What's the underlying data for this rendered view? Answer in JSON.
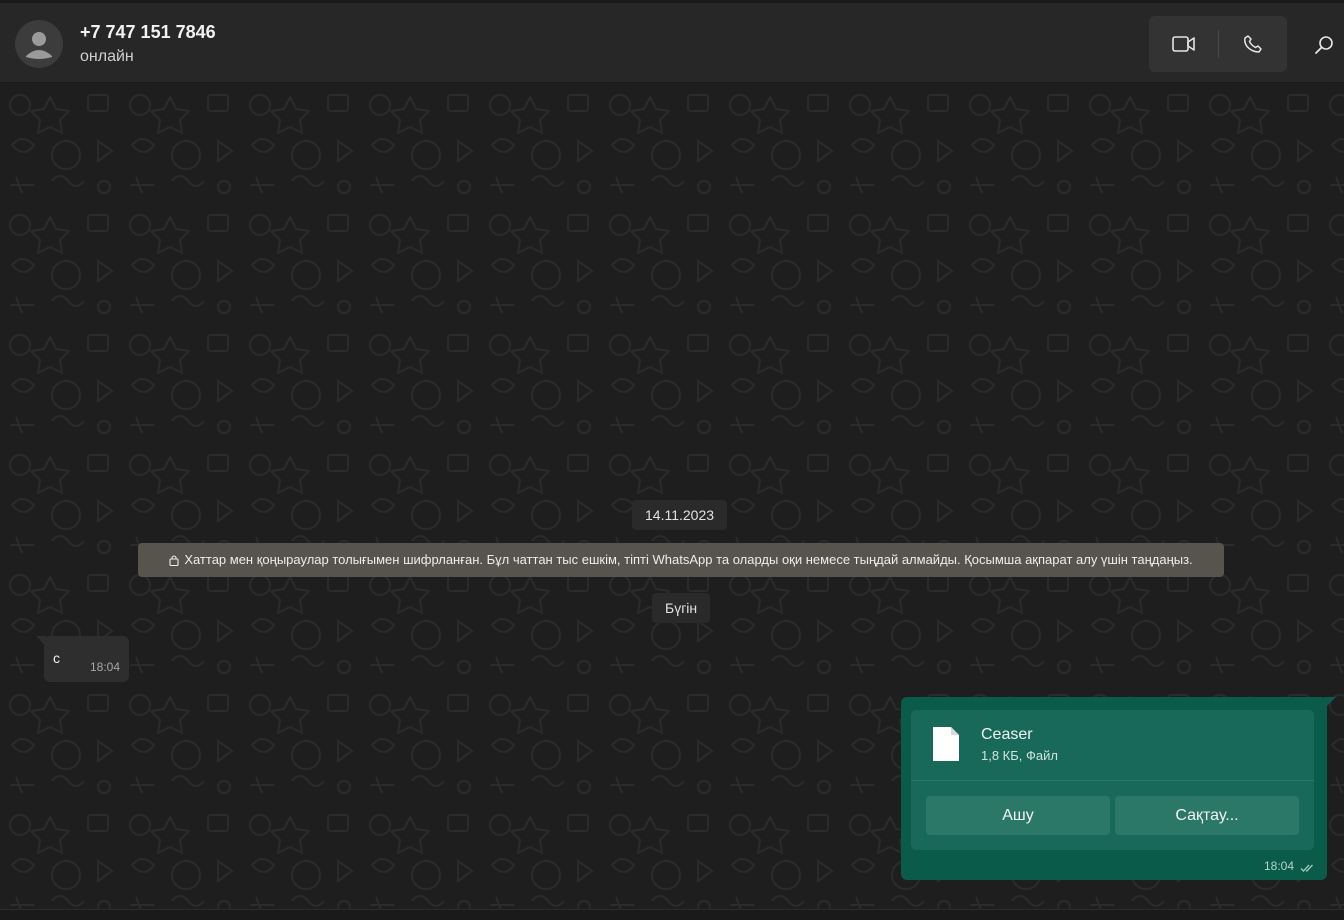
{
  "header": {
    "contact_name": "+7 747 151 7846",
    "contact_status": "онлайн",
    "icons": [
      "avatar-placeholder-icon",
      "video-call-icon",
      "voice-call-icon",
      "search-icon"
    ]
  },
  "chat": {
    "date_divider_1": "14.11.2023",
    "encryption_notice": "Хаттар мен қоңыраулар толығымен шифрланған. Бұл чаттан тыс ешкім, тіпті WhatsApp та оларды оқи немесе тыңдай алмайды. Қосымша ақпарат алу үшін таңдаңыз.",
    "date_divider_2": "Бүгін",
    "incoming_message": {
      "text": "с",
      "time": "18:04"
    },
    "outgoing_message": {
      "file_name": "Ceaser",
      "file_meta": "1,8 КБ, Файл",
      "open_label": "Ашу",
      "save_label": "Сақтау...",
      "time": "18:04",
      "status": "read"
    }
  },
  "colors": {
    "header_bg": "#272727",
    "chat_bg": "#1e1e1e",
    "notice_bg": "#57544e",
    "incoming_bg": "#2e2e2e",
    "outgoing_bg": "#0b5b4a",
    "file_card_bg": "#18695a",
    "file_button_bg": "#2b7868"
  }
}
